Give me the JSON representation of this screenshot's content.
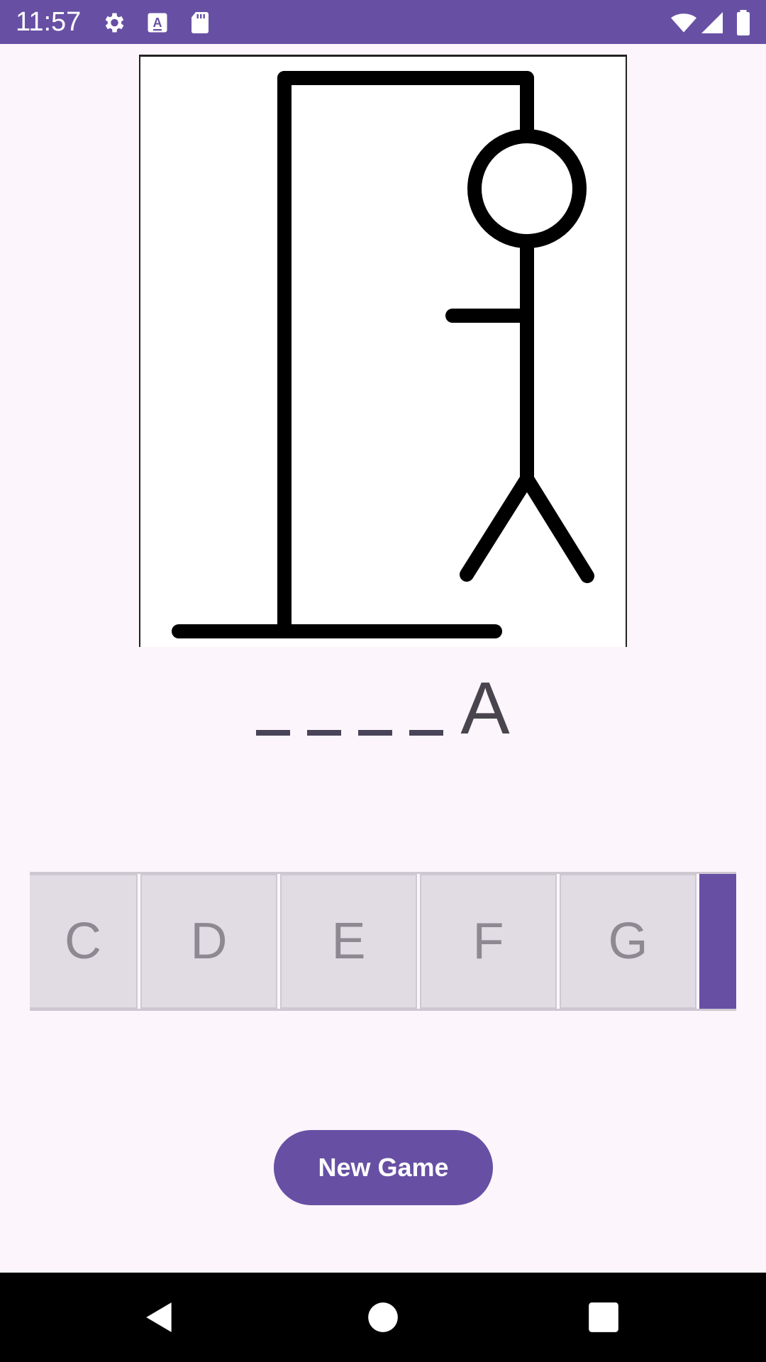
{
  "status_bar": {
    "time": "11:57",
    "background_color": "#6750a4",
    "icons_left": [
      "settings-icon",
      "accessibility-text-icon",
      "sd-card-icon"
    ],
    "icons_right": [
      "wifi-icon",
      "signal-icon",
      "battery-icon"
    ]
  },
  "game": {
    "image": "hangman-drawing",
    "word": [
      "_",
      "_",
      "_",
      "_",
      "A"
    ],
    "keyboard": {
      "visible_keys": [
        "C",
        "D",
        "E",
        "F",
        "G"
      ]
    },
    "new_game_label": "New Game"
  },
  "colors": {
    "accent": "#6750a4",
    "background": "#fcf5fc",
    "key_background": "#e1dbe3",
    "key_text": "#8d8892",
    "word_text": "#49454f"
  },
  "nav_bar": {
    "buttons": [
      "back-icon",
      "home-icon",
      "recents-icon"
    ]
  }
}
